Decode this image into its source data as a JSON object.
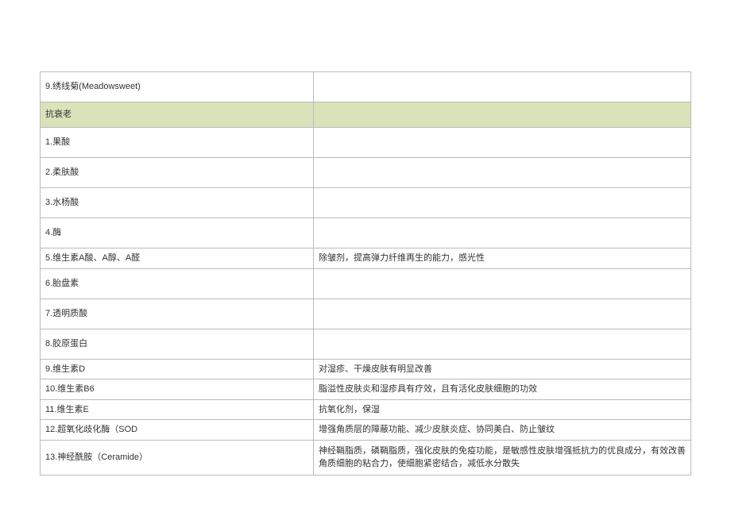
{
  "rows": [
    {
      "left": "9.绣线菊(Meadowsweet)",
      "right": "",
      "class": "tall-row"
    },
    {
      "left": "抗衰老",
      "right": "",
      "class": "section-header"
    },
    {
      "left": "1.果酸",
      "right": "",
      "class": "tall-row"
    },
    {
      "left": "2.柔肤酸",
      "right": "",
      "class": "tall-row"
    },
    {
      "left": "3.水杨酸",
      "right": "",
      "class": "tall-row"
    },
    {
      "left": "4.酶",
      "right": "",
      "class": "tall-row"
    },
    {
      "left": "5.维生素A酸、A醇、A醛",
      "right": "除皱剂，提高弹力纤维再生的能力，感光性",
      "class": "normal-row"
    },
    {
      "left": "6.胎盘素",
      "right": "",
      "class": "tall-row"
    },
    {
      "left": "7.透明质酸",
      "right": "",
      "class": "tall-row"
    },
    {
      "left": "8.胶原蛋白",
      "right": "",
      "class": "tall-row"
    },
    {
      "left": "9.维生素D",
      "right": "对湿疹、干燥皮肤有明显改善",
      "class": "normal-row"
    },
    {
      "left": "10.维生素B6",
      "right": "脂溢性皮肤炎和湿疹具有疗效，且有活化皮肤细胞的功效",
      "class": "normal-row"
    },
    {
      "left": "11.维生素E",
      "right": "抗氧化剂，保湿",
      "class": "normal-row"
    },
    {
      "left": "12.超氧化歧化酶（SOD",
      "right": "增强角质层的障蔽功能、减少皮肤炎症、协同美白、防止皱纹",
      "class": "normal-row"
    },
    {
      "left": "13.神经酰胺（Ceramide）",
      "right": "神经鞘脂质，磷鞘脂质，强化皮肤的免疫功能，是敏感性皮肤增强抵抗力的优良成分，有效改善角质细胞的粘合力，使细胞紧密结合，减低水分散失",
      "class": "multi-row"
    }
  ]
}
